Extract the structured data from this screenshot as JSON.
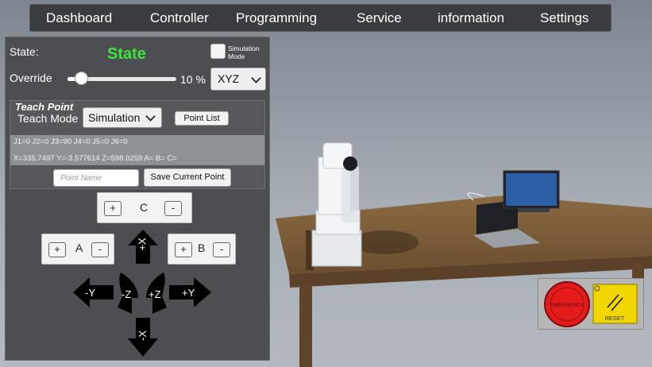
{
  "nav": {
    "items": [
      {
        "label": "Dashboard"
      },
      {
        "label": "Controller"
      },
      {
        "label": "Programming"
      },
      {
        "label": "Service"
      },
      {
        "label": "information"
      },
      {
        "label": "Settings"
      }
    ]
  },
  "status": {
    "state_label": "State:",
    "state_value": "State",
    "state_color": "#3be53b",
    "simulation_mode_line1": "Simulation",
    "simulation_mode_line2": "Mode",
    "simulation_mode_checked": false
  },
  "override": {
    "label": "Override",
    "value_text": "10 %",
    "value_fraction": 0.1
  },
  "frame_select": {
    "selected": "XYZ"
  },
  "teach_point": {
    "title": "Teach Point",
    "mode_label": "Teach Mode",
    "mode_selected": "Simulation",
    "point_list_button": "Point List",
    "joints_text": "J1=0 J2=0 J3=90 J4=0 J5=0 J6=0",
    "pose_text": "X=335.7497 Y=-3.577614 Z=598.0259 A= B= C=",
    "point_name_placeholder": "Point Name",
    "save_button": "Save Current Point"
  },
  "jog": {
    "plus": "+",
    "minus": "-",
    "axis_c": "C",
    "axis_a": "A",
    "axis_b": "B",
    "x_plus": "+X",
    "x_minus": "-X",
    "y_plus": "+Y",
    "y_minus": "-Y",
    "z_plus": "+Z",
    "z_minus": "-Z"
  },
  "safety": {
    "estop_label": "EMERGENCY",
    "reset_label": "RESET",
    "estop_color": "#e41b1b",
    "reset_color": "#f2d600"
  }
}
